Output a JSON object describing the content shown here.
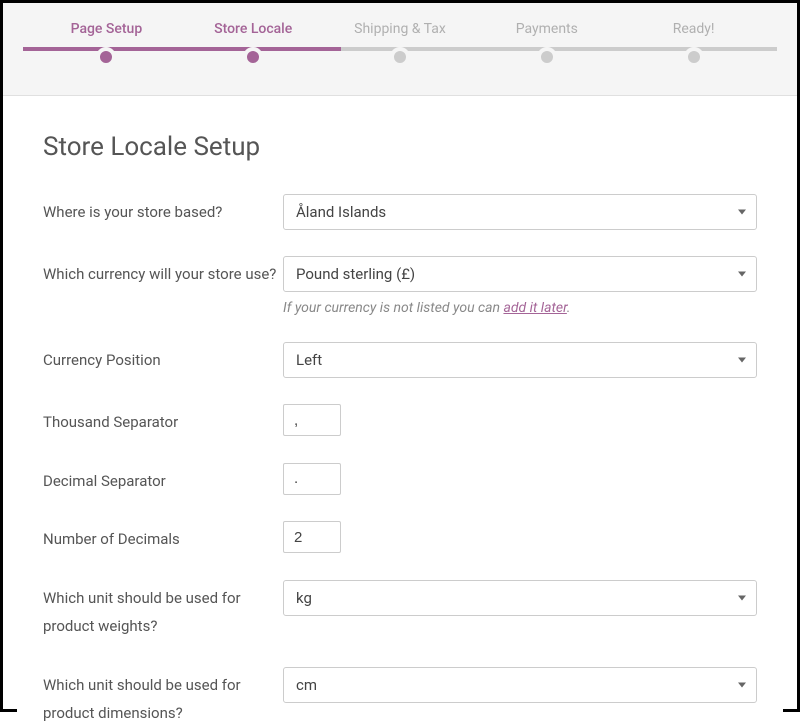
{
  "stepper": {
    "steps": [
      {
        "label": "Page Setup",
        "state": "complete"
      },
      {
        "label": "Store Locale",
        "state": "active"
      },
      {
        "label": "Shipping & Tax",
        "state": "pending"
      },
      {
        "label": "Payments",
        "state": "pending"
      },
      {
        "label": "Ready!",
        "state": "pending"
      }
    ],
    "progress_percent": 40
  },
  "page": {
    "title": "Store Locale Setup"
  },
  "form": {
    "store_based": {
      "label": "Where is your store based?",
      "value": "Åland Islands"
    },
    "currency": {
      "label": "Which currency will your store use?",
      "value": "Pound sterling (£)",
      "hint_prefix": "If your currency is not listed you can ",
      "hint_link": "add it later",
      "hint_suffix": "."
    },
    "currency_position": {
      "label": "Currency Position",
      "value": "Left"
    },
    "thousand_sep": {
      "label": "Thousand Separator",
      "value": ","
    },
    "decimal_sep": {
      "label": "Decimal Separator",
      "value": "."
    },
    "num_decimals": {
      "label": "Number of Decimals",
      "value": "2"
    },
    "weight_unit": {
      "label": "Which unit should be used for product weights?",
      "value": "kg"
    },
    "dimension_unit": {
      "label": "Which unit should be used for product dimensions?",
      "value": "cm"
    }
  }
}
